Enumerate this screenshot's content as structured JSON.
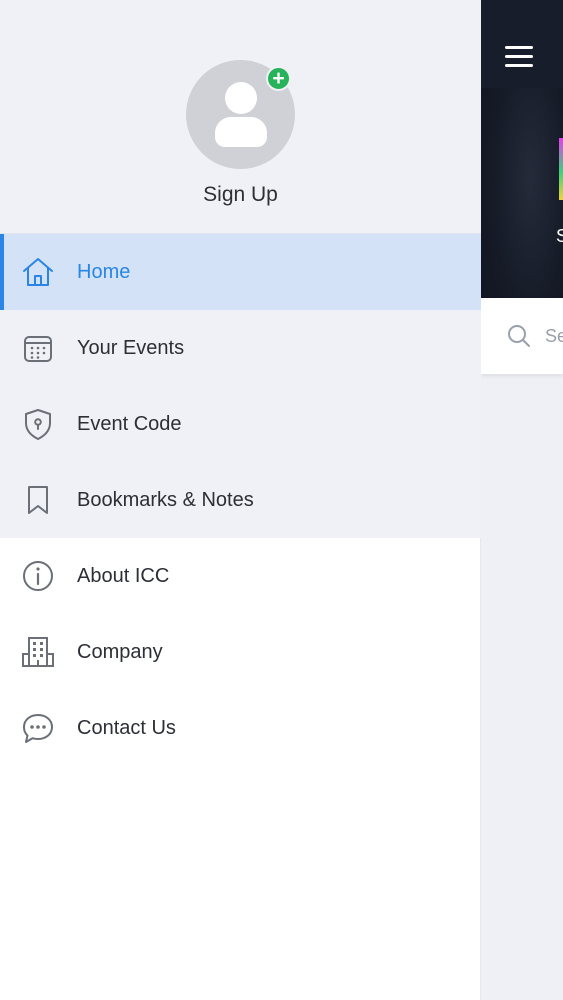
{
  "profile": {
    "avatar_icon": "user-avatar-icon",
    "badge_icon": "plus-circle-icon",
    "badge_symbol": "+",
    "signup_label": "Sign Up"
  },
  "menu": {
    "items": [
      {
        "label": "Home",
        "icon": "home-icon",
        "active": true
      },
      {
        "label": "Your Events",
        "icon": "calendar-icon",
        "active": false
      },
      {
        "label": "Event Code",
        "icon": "shield-icon",
        "active": false
      },
      {
        "label": "Bookmarks & Notes",
        "icon": "bookmark-icon",
        "active": false
      },
      {
        "label": "About ICC",
        "icon": "info-icon",
        "active": false
      },
      {
        "label": "Company",
        "icon": "building-icon",
        "active": false
      },
      {
        "label": "Contact Us",
        "icon": "chat-bubble-icon",
        "active": false
      }
    ]
  },
  "background_app": {
    "menu_icon": "hamburger-icon",
    "banner_text_peek": "S",
    "search_placeholder_peek": "Se"
  },
  "colors": {
    "accent": "#2a86e6",
    "active_bg": "#d3e2f7",
    "badge_green": "#27b35a",
    "drawer_shaded_bg": "#f0f1f6",
    "header_dark": "#181d2b"
  }
}
